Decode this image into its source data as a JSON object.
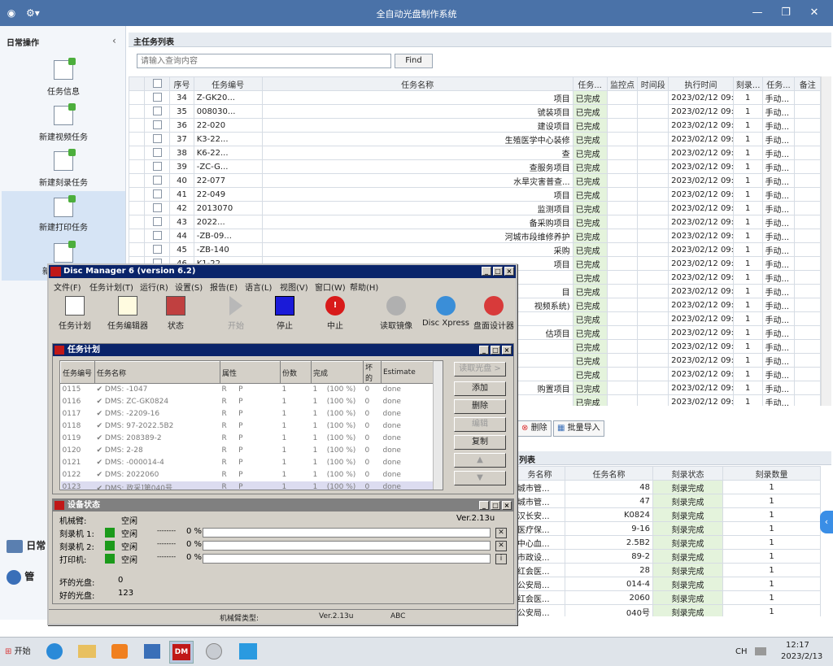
{
  "app": {
    "title": "全自动光盘制作系统"
  },
  "sidebar": {
    "header": "日常操作",
    "items": [
      {
        "label": "任务信息"
      },
      {
        "label": "新建视频任务"
      },
      {
        "label": "新建刻录任务"
      },
      {
        "label": "新建打印任务"
      },
      {
        "label": "新"
      }
    ],
    "bottom": [
      {
        "label": "日常"
      },
      {
        "label": "管"
      }
    ]
  },
  "main": {
    "panel_title": "主任务列表",
    "search": {
      "placeholder": "请输入查询内容",
      "button": "Find"
    },
    "columns": [
      "序号",
      "任务编号",
      "任务名称",
      "任务...",
      "监控点",
      "时间段",
      "执行时间",
      "刻录...",
      "任务...",
      "备注"
    ],
    "rows": [
      {
        "no": "34",
        "code": "Z-GK20...",
        "name": "项目",
        "status": "已完成",
        "time": "2023/02/12 09:4...",
        "count": "1",
        "type": "手动..."
      },
      {
        "no": "35",
        "code": "008030...",
        "name": "號装项目",
        "status": "已完成",
        "time": "2023/02/12 09:4...",
        "count": "1",
        "type": "手动..."
      },
      {
        "no": "36",
        "code": "22-020",
        "name": "建设项目",
        "status": "已完成",
        "time": "2023/02/12 09:4...",
        "count": "1",
        "type": "手动..."
      },
      {
        "no": "37",
        "code": "K3-22...",
        "name": "生殖医学中心装修",
        "status": "已完成",
        "time": "2023/02/12 09:4...",
        "count": "1",
        "type": "手动..."
      },
      {
        "no": "38",
        "code": "K6-22...",
        "name": "查",
        "status": "已完成",
        "time": "2023/02/12 09:4...",
        "count": "1",
        "type": "手动..."
      },
      {
        "no": "39",
        "code": "-ZC-G...",
        "name": "查服务项目",
        "status": "已完成",
        "time": "2023/02/12 09:4...",
        "count": "1",
        "type": "手动..."
      },
      {
        "no": "40",
        "code": "22-077",
        "name": "水旱灾害普查...",
        "status": "已完成",
        "time": "2023/02/12 09:4...",
        "count": "1",
        "type": "手动..."
      },
      {
        "no": "41",
        "code": "22-049",
        "name": "项目",
        "status": "已完成",
        "time": "2023/02/12 09:4...",
        "count": "1",
        "type": "手动..."
      },
      {
        "no": "42",
        "code": "2013070",
        "name": "监测项目",
        "status": "已完成",
        "time": "2023/02/12 09:4...",
        "count": "1",
        "type": "手动..."
      },
      {
        "no": "43",
        "code": "2022...",
        "name": "备采购项目",
        "status": "已完成",
        "time": "2023/02/12 09:4...",
        "count": "1",
        "type": "手动..."
      },
      {
        "no": "44",
        "code": "-ZB-09...",
        "name": "河城市段维修养护",
        "status": "已完成",
        "time": "2023/02/12 09:4...",
        "count": "1",
        "type": "手动..."
      },
      {
        "no": "45",
        "code": "-ZB-140",
        "name": "采购",
        "status": "已完成",
        "time": "2023/02/12 09:4...",
        "count": "1",
        "type": "手动..."
      },
      {
        "no": "46",
        "code": "K1-22...",
        "name": "项目",
        "status": "已完成",
        "time": "2023/02/12 09:4...",
        "count": "1",
        "type": "手动..."
      },
      {
        "no": "",
        "code": "",
        "name": "",
        "status": "已完成",
        "time": "2023/02/12 09:4...",
        "count": "1",
        "type": "手动..."
      },
      {
        "no": "",
        "code": "",
        "name": "目",
        "status": "已完成",
        "time": "2023/02/12 09:4...",
        "count": "1",
        "type": "手动..."
      },
      {
        "no": "",
        "code": "",
        "name": "视频系统)",
        "status": "已完成",
        "time": "2023/02/12 09:4...",
        "count": "1",
        "type": "手动..."
      },
      {
        "no": "",
        "code": "",
        "name": "",
        "status": "已完成",
        "time": "2023/02/12 09:4...",
        "count": "1",
        "type": "手动..."
      },
      {
        "no": "",
        "code": "",
        "name": "估项目",
        "status": "已完成",
        "time": "2023/02/12 09:4...",
        "count": "1",
        "type": "手动..."
      },
      {
        "no": "",
        "code": "",
        "name": "",
        "status": "已完成",
        "time": "2023/02/12 09:4...",
        "count": "1",
        "type": "手动..."
      },
      {
        "no": "",
        "code": "",
        "name": "",
        "status": "已完成",
        "time": "2023/02/12 09:4...",
        "count": "1",
        "type": "手动..."
      },
      {
        "no": "",
        "code": "",
        "name": "",
        "status": "已完成",
        "time": "2023/02/12 09:4...",
        "count": "1",
        "type": "手动..."
      },
      {
        "no": "",
        "code": "",
        "name": "购置项目",
        "status": "已完成",
        "time": "2023/02/12 09:4...",
        "count": "1",
        "type": "手动..."
      },
      {
        "no": "",
        "code": "",
        "name": "",
        "status": "已完成",
        "time": "2023/02/12 09:4...",
        "count": "1",
        "type": "手动..."
      }
    ],
    "actions": {
      "delete": "删除",
      "import": "批量导入"
    }
  },
  "burn": {
    "panel_title": "列表",
    "columns": [
      "务名称",
      "任务名称",
      "刻录状态",
      "刻录数量"
    ],
    "rows": [
      {
        "a": "城市管...",
        "b": "48",
        "status": "刻录完成",
        "count": "1"
      },
      {
        "a": "城市管...",
        "b": "47",
        "status": "刻录完成",
        "count": "1"
      },
      {
        "a": "汉长安...",
        "b": "K0824",
        "status": "刻录完成",
        "count": "1"
      },
      {
        "a": "医疗保...",
        "b": "9-16",
        "status": "刻录完成",
        "count": "1"
      },
      {
        "a": "中心血...",
        "b": "2.5B2",
        "status": "刻录完成",
        "count": "1"
      },
      {
        "a": "市政设...",
        "b": "89-2",
        "status": "刻录完成",
        "count": "1"
      },
      {
        "a": "红会医...",
        "b": "28",
        "status": "刻录完成",
        "count": "1"
      },
      {
        "a": "公安局...",
        "b": "014-4",
        "status": "刻录完成",
        "count": "1"
      },
      {
        "a": "红会医...",
        "b": "2060",
        "status": "刻录完成",
        "count": "1"
      },
      {
        "a": "公安局...",
        "b": "040号",
        "status": "刻录完成",
        "count": "1"
      }
    ]
  },
  "dm": {
    "title": "Disc Manager 6    (version 6.2)",
    "menu": [
      "文件(F)",
      "任务计划(T)",
      "运行(R)",
      "设置(S)",
      "报告(E)",
      "语言(L)",
      "视图(V)",
      "窗口(W)",
      "帮助(H)"
    ],
    "toolbar": [
      "任务计划",
      "任务编辑器",
      "状态",
      "开始",
      "停止",
      "中止",
      "读取镜像",
      "Disc Xpress",
      "盘面设计器"
    ],
    "task_window": {
      "title": "任务计划",
      "columns": [
        "任务编号",
        "任务名称",
        "属性",
        "份数",
        "完成",
        "坏的",
        "Estimate"
      ],
      "rows": [
        {
          "id": "0115",
          "name": "DMS:",
          "tail": "-1047",
          "a": "R",
          "b": "P",
          "n": "1",
          "d": "1",
          "pct": "(100 %)",
          "bad": "0",
          "est": "done"
        },
        {
          "id": "0116",
          "name": "DMS:",
          "tail": "ZC-GK0824",
          "a": "R",
          "b": "P",
          "n": "1",
          "d": "1",
          "pct": "(100 %)",
          "bad": "0",
          "est": "done"
        },
        {
          "id": "0117",
          "name": "DMS:",
          "tail": "-2209-16",
          "a": "R",
          "b": "P",
          "n": "1",
          "d": "1",
          "pct": "(100 %)",
          "bad": "0",
          "est": "done"
        },
        {
          "id": "0118",
          "name": "DMS:",
          "tail": "97-2022.5B2",
          "a": "R",
          "b": "P",
          "n": "1",
          "d": "1",
          "pct": "(100 %)",
          "bad": "0",
          "est": "done"
        },
        {
          "id": "0119",
          "name": "DMS:",
          "tail": "208389-2",
          "a": "R",
          "b": "P",
          "n": "1",
          "d": "1",
          "pct": "(100 %)",
          "bad": "0",
          "est": "done"
        },
        {
          "id": "0120",
          "name": "DMS:",
          "tail": "2-28",
          "a": "R",
          "b": "P",
          "n": "1",
          "d": "1",
          "pct": "(100 %)",
          "bad": "0",
          "est": "done"
        },
        {
          "id": "0121",
          "name": "DMS:",
          "tail": "-000014-4",
          "a": "R",
          "b": "P",
          "n": "1",
          "d": "1",
          "pct": "(100 %)",
          "bad": "0",
          "est": "done"
        },
        {
          "id": "0122",
          "name": "DMS:",
          "tail": "2022060",
          "a": "R",
          "b": "P",
          "n": "1",
          "d": "1",
          "pct": "(100 %)",
          "bad": "0",
          "est": "done"
        },
        {
          "id": "0123",
          "name": "DMS:",
          "tail": "政采]第040号",
          "a": "R",
          "b": "P",
          "n": "1",
          "d": "1",
          "pct": "(100 %)",
          "bad": "0",
          "est": "done"
        }
      ],
      "buttons": [
        "读取光盘 >",
        "添加",
        "删除",
        "编辑",
        "复制",
        "▲",
        "▼"
      ]
    },
    "device_window": {
      "title": "设备状态",
      "version": "Ver.2.13u",
      "arm_label": "机械臂:",
      "arm_status": "空闲",
      "devices": [
        {
          "name": "刻录机 1:",
          "status": "空闲",
          "dash": "--------",
          "pct": "0 %"
        },
        {
          "name": "刻录机 2:",
          "status": "空闲",
          "dash": "--------",
          "pct": "0 %"
        },
        {
          "name": "打印机:",
          "status": "空闲",
          "dash": "--------",
          "pct": "0 %"
        }
      ],
      "bad_label": "坏的光盘:",
      "bad_value": "0",
      "good_label": "好的光盘:",
      "good_value": "123"
    },
    "statusbar": {
      "arm_type": "机械臂类型:",
      "version": "Ver.2.13u",
      "abc": "ABC"
    }
  },
  "taskbar": {
    "start": "开始",
    "lang": "CH",
    "time": "12:17",
    "date": "2023/2/13"
  }
}
